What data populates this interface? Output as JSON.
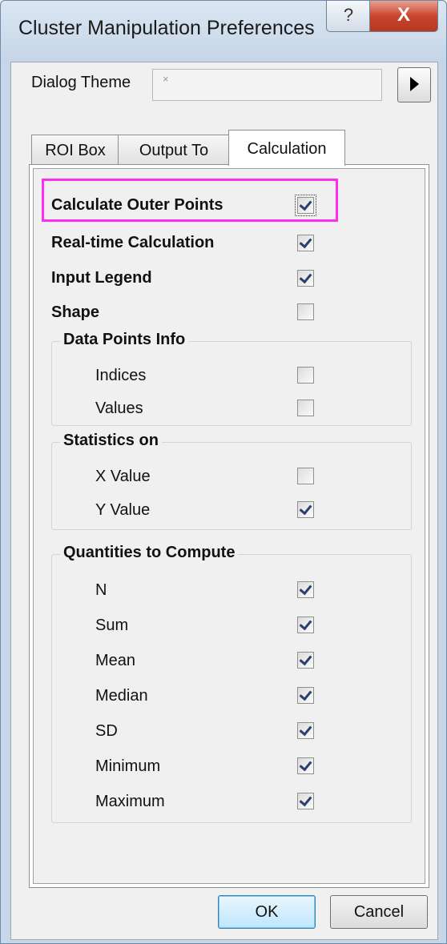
{
  "window": {
    "title": "Cluster Manipulation Preferences",
    "help_glyph": "?",
    "close_glyph": "X"
  },
  "theme": {
    "label": "Dialog Theme",
    "value": "×"
  },
  "tabs": [
    {
      "label": "ROI Box",
      "active": false
    },
    {
      "label": "Output To",
      "active": false
    },
    {
      "label": "Calculation",
      "active": true
    }
  ],
  "options": {
    "calculate_outer_points": {
      "label": "Calculate Outer Points",
      "checked": true
    },
    "real_time_calculation": {
      "label": "Real-time Calculation",
      "checked": true
    },
    "input_legend": {
      "label": "Input Legend",
      "checked": true
    },
    "shape": {
      "label": "Shape",
      "checked": false
    }
  },
  "data_points_info": {
    "title": "Data Points Info",
    "items": [
      {
        "label": "Indices",
        "checked": false
      },
      {
        "label": "Values",
        "checked": false
      }
    ]
  },
  "statistics_on": {
    "title": "Statistics on",
    "items": [
      {
        "label": "X Value",
        "checked": false
      },
      {
        "label": "Y Value",
        "checked": true
      }
    ]
  },
  "quantities": {
    "title": "Quantities to Compute",
    "items": [
      {
        "label": "N",
        "checked": true
      },
      {
        "label": "Sum",
        "checked": true
      },
      {
        "label": "Mean",
        "checked": true
      },
      {
        "label": "Median",
        "checked": true
      },
      {
        "label": "SD",
        "checked": true
      },
      {
        "label": "Minimum",
        "checked": true
      },
      {
        "label": "Maximum",
        "checked": true
      }
    ]
  },
  "buttons": {
    "ok": "OK",
    "cancel": "Cancel"
  },
  "colors": {
    "highlight": "#ff2df0",
    "check": "#2b3f6e",
    "close_button": "#c9452c"
  }
}
